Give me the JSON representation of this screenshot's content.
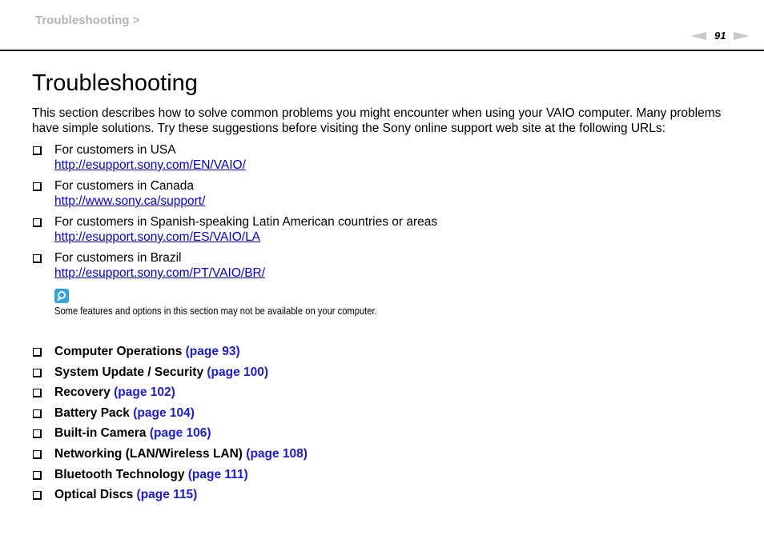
{
  "header": {
    "breadcrumb": "Troubleshooting >",
    "page_number": "91",
    "prev_icon": "triangle-left-icon",
    "next_icon": "triangle-right-icon"
  },
  "title": "Troubleshooting",
  "intro": "This section describes how to solve common problems you might encounter when using your VAIO computer. Many problems have simple solutions. Try these suggestions before visiting the Sony online support web site at the following URLs:",
  "support_sites": [
    {
      "label": "For customers in USA",
      "url": "http://esupport.sony.com/EN/VAIO/"
    },
    {
      "label": "For customers in Canada",
      "url": "http://www.sony.ca/support/"
    },
    {
      "label": "For customers in Spanish-speaking Latin American countries or areas",
      "url": "http://esupport.sony.com/ES/VAIO/LA"
    },
    {
      "label": "For customers in Brazil",
      "url": "http://esupport.sony.com/PT/VAIO/BR/"
    }
  ],
  "note": {
    "icon": "magnifier-note-icon",
    "text": "Some features and options in this section may not be available on your computer."
  },
  "topics": [
    {
      "label": "Computer Operations",
      "page": "(page 93)"
    },
    {
      "label": "System Update / Security",
      "page": "(page 100)"
    },
    {
      "label": "Recovery",
      "page": "(page 102)"
    },
    {
      "label": "Battery Pack",
      "page": "(page 104)"
    },
    {
      "label": "Built-in Camera",
      "page": "(page 106)"
    },
    {
      "label": "Networking (LAN/Wireless LAN)",
      "page": "(page 108)"
    },
    {
      "label": "Bluetooth Technology",
      "page": "(page 111)"
    },
    {
      "label": "Optical Discs",
      "page": "(page 115)"
    }
  ]
}
